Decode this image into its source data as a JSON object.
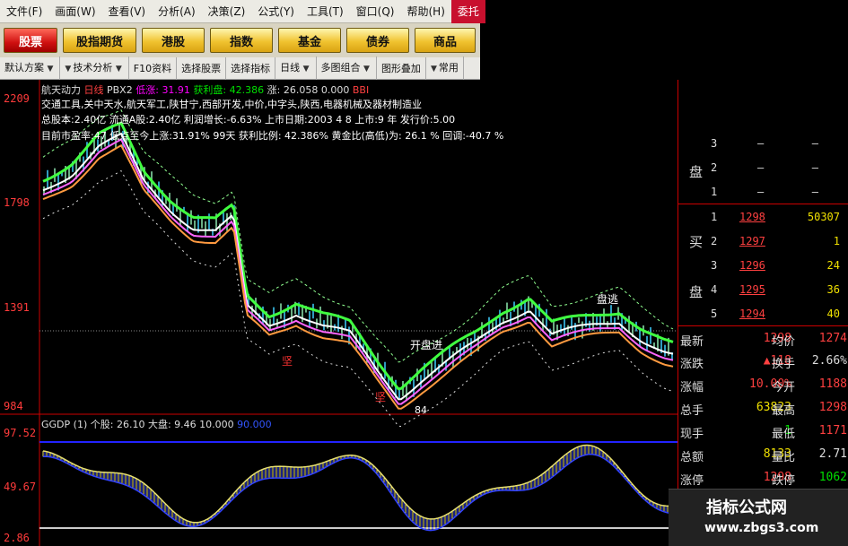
{
  "menu": [
    "文件(F)",
    "画面(W)",
    "查看(V)",
    "分析(A)",
    "决策(Z)",
    "公式(Y)",
    "工具(T)",
    "窗口(Q)",
    "帮助(H)",
    "委托"
  ],
  "market_tabs": [
    "股票",
    "股指期货",
    "港股",
    "指数",
    "基金",
    "债券",
    "商品"
  ],
  "indicator_tools": [
    "默认方案",
    "技术分析",
    "F10资料",
    "选择股票",
    "选择指标",
    "日线",
    "多图组合",
    "图形叠加",
    "常用"
  ],
  "chart": {
    "header": [
      "航天动力",
      "日线",
      "PBX2",
      "低涨:",
      "31.91",
      "获利盘:",
      "42.386",
      "涨:",
      "26.058",
      "0.000",
      "BBI"
    ],
    "line1": "交通工具,关中天水,航天军工,陕甘宁,西部开发,中价,中字头,陕西,电器机械及器材制造业",
    "line2": "总股本:2.40亿  流通A股:2.40亿  利润增长:-6.63%  上市日期:2003 4 8 上市:9 年 发行价:5.00",
    "line3": "目前市盈率:47  低点至今上涨:31.91% 99天  获利比例: 42.386% 黄金比(高低)为: 26.1 % 回调:-40.7 %",
    "y_labels": [
      "2209",
      "1798",
      "1391",
      "984"
    ],
    "sub_header": [
      "GGDP (1)",
      "个股:",
      "26.10",
      "大盘:",
      "9.46",
      "10.000",
      "90.000"
    ],
    "sub_y_labels": [
      "97.52",
      "49.67",
      "2.86"
    ],
    "annotations": [
      "盘逃",
      "开盘进",
      "坚",
      "坚",
      "84"
    ]
  },
  "order_book": {
    "sell_label": "盘",
    "buy_chars": [
      "买",
      "盘"
    ],
    "sell": [
      {
        "level": "3",
        "price": "–",
        "vol": "–"
      },
      {
        "level": "2",
        "price": "–",
        "vol": "–"
      },
      {
        "level": "1",
        "price": "–",
        "vol": "–"
      }
    ],
    "buy": [
      {
        "level": "1",
        "price": "1298",
        "vol": "50307"
      },
      {
        "level": "2",
        "price": "1297",
        "vol": "1"
      },
      {
        "level": "3",
        "price": "1296",
        "vol": "24"
      },
      {
        "level": "4",
        "price": "1295",
        "vol": "36"
      },
      {
        "level": "5",
        "price": "1294",
        "vol": "40"
      }
    ]
  },
  "quote": [
    {
      "l1": "最新",
      "v1": "1298",
      "l2": "均价",
      "v2": "1274"
    },
    {
      "l1": "涨跌",
      "v1": "▲118",
      "l2": "换手",
      "v2": "2.66%"
    },
    {
      "l1": "涨幅",
      "v1": "10.00%",
      "l2": "今开",
      "v2": "1188"
    },
    {
      "l1": "总手",
      "v1": "63823",
      "l2": "最高",
      "v2": "1298"
    },
    {
      "l1": "现手",
      "v1": "1",
      "l2": "最低",
      "v2": "1171"
    },
    {
      "l1": "总额",
      "v1": "8133",
      "l2": "量比",
      "v2": "2.71"
    },
    {
      "l1": "涨停",
      "v1": "1298",
      "l2": "跌停",
      "v2": "1062"
    }
  ],
  "watermark": {
    "title": "指标公式网",
    "url": "www.zbgs3.com"
  },
  "colors": {
    "up": "#ff4040",
    "down": "#00c000",
    "accent": "#c8102e",
    "yellow": "#f0e000"
  }
}
